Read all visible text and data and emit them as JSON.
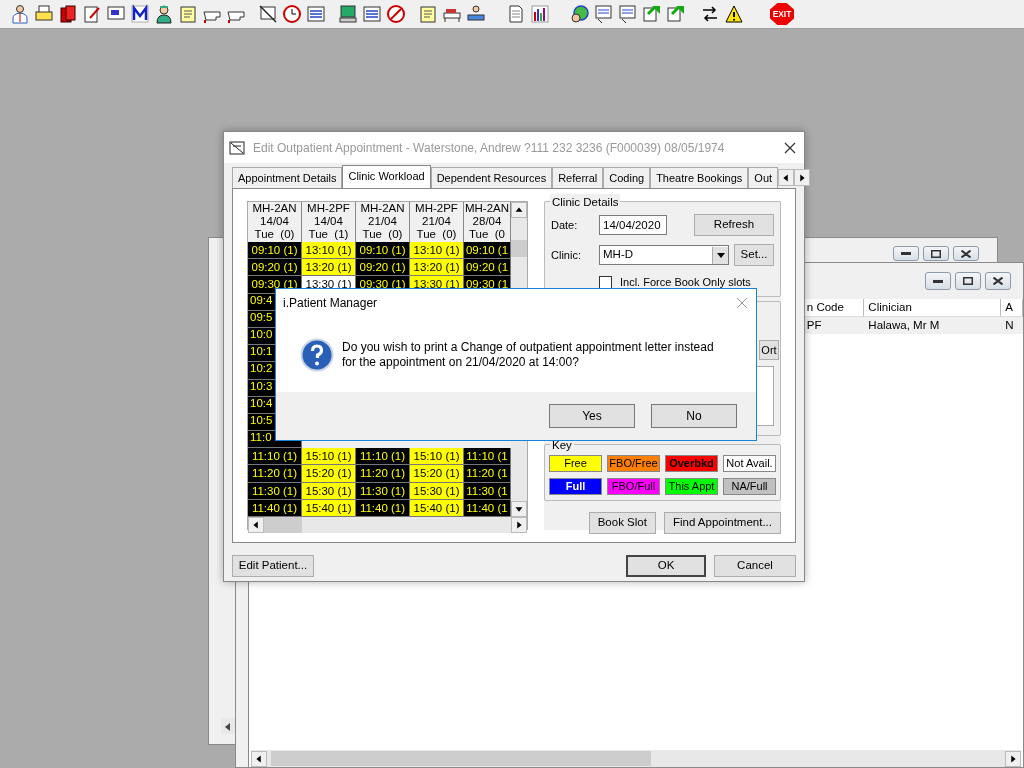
{
  "toolbar": {
    "exit_label": "EXIT"
  },
  "list_window": {
    "columns": [
      "n Code",
      "Clinician",
      "A"
    ],
    "rows": [
      [
        "PF",
        "Halawa, Mr M",
        "N"
      ]
    ]
  },
  "dialog": {
    "title": "Edit Outpatient Appointment - Waterstone, Andrew ?111 232 3236 (F000039) 08/05/1974",
    "tabs": [
      {
        "label": "Appointment Details",
        "selected": false
      },
      {
        "label": "Clinic Workload",
        "selected": true
      },
      {
        "label": "Dependent Resources",
        "selected": false
      },
      {
        "label": "Referral",
        "selected": false
      },
      {
        "label": "Coding",
        "selected": false
      },
      {
        "label": "Theatre Bookings",
        "selected": false
      },
      {
        "label": "Out",
        "selected": false
      }
    ],
    "grid": {
      "columns": [
        {
          "code": "MH-2AN",
          "date": "14/04",
          "day": "Tue  (0)"
        },
        {
          "code": "MH-2PF",
          "date": "14/04",
          "day": "Tue  (1)"
        },
        {
          "code": "MH-2AN",
          "date": "21/04",
          "day": "Tue  (0)"
        },
        {
          "code": "MH-2PF",
          "date": "21/04",
          "day": "Tue  (0)"
        },
        {
          "code": "MH-2AN",
          "date": "28/04",
          "day": "Tue  (0"
        }
      ],
      "rows": [
        {
          "cells": [
            {
              "text": "09:10 (1)",
              "color": "#000000"
            },
            {
              "text": "13:10 (1)",
              "color": "#ffff00"
            },
            {
              "text": "09:10 (1)",
              "color": "#000000"
            },
            {
              "text": "13:10 (1)",
              "color": "#ffff00"
            },
            {
              "text": "09:10 (1",
              "color": "#000000"
            }
          ]
        },
        {
          "cells": [
            {
              "text": "09:20 (1)",
              "color": "#000000"
            },
            {
              "text": "13:20 (1)",
              "color": "#ffff00"
            },
            {
              "text": "09:20 (1)",
              "color": "#000000"
            },
            {
              "text": "13:20 (1)",
              "color": "#ffff00"
            },
            {
              "text": "09:20 (1",
              "color": "#000000"
            }
          ]
        },
        {
          "cells": [
            {
              "text": "09:30 (1)",
              "color": "#000000"
            },
            {
              "text": "13:30 (1)",
              "color": "#ffffff"
            },
            {
              "text": "09:30 (1)",
              "color": "#000000"
            },
            {
              "text": "13:30 (1)",
              "color": "#ffff00"
            },
            {
              "text": "09:30 (1",
              "color": "#000000"
            }
          ]
        },
        {
          "cells": [
            {
              "text": "09:4",
              "color": "#000000"
            }
          ]
        },
        {
          "cells": [
            {
              "text": "09:5",
              "color": "#000000"
            }
          ]
        },
        {
          "cells": [
            {
              "text": "10:0",
              "color": "#000000"
            }
          ]
        },
        {
          "cells": [
            {
              "text": "10:1",
              "color": "#000000"
            }
          ]
        },
        {
          "cells": [
            {
              "text": "10:2",
              "color": "#000000"
            }
          ]
        },
        {
          "cells": [
            {
              "text": "10:3",
              "color": "#000000"
            }
          ]
        },
        {
          "cells": [
            {
              "text": "10:4",
              "color": "#000000"
            }
          ]
        },
        {
          "cells": [
            {
              "text": "10:5",
              "color": "#000000"
            }
          ]
        },
        {
          "cells": [
            {
              "text": "11:0",
              "color": "#000000"
            }
          ]
        },
        {
          "cells": [
            {
              "text": "11:10 (1)",
              "color": "#000000"
            },
            {
              "text": "15:10 (1)",
              "color": "#ffff00"
            },
            {
              "text": "11:10 (1)",
              "color": "#000000"
            },
            {
              "text": "15:10 (1)",
              "color": "#ffff00"
            },
            {
              "text": "11:10 (1",
              "color": "#000000"
            }
          ]
        },
        {
          "cells": [
            {
              "text": "11:20 (1)",
              "color": "#000000"
            },
            {
              "text": "15:20 (1)",
              "color": "#ffff00"
            },
            {
              "text": "11:20 (1)",
              "color": "#000000"
            },
            {
              "text": "15:20 (1)",
              "color": "#ffff00"
            },
            {
              "text": "11:20 (1",
              "color": "#000000"
            }
          ]
        },
        {
          "cells": [
            {
              "text": "11:30 (1)",
              "color": "#000000"
            },
            {
              "text": "15:30 (1)",
              "color": "#ffff00"
            },
            {
              "text": "11:30 (1)",
              "color": "#000000"
            },
            {
              "text": "15:30 (1)",
              "color": "#ffff00"
            },
            {
              "text": "11:30 (1",
              "color": "#000000"
            }
          ]
        },
        {
          "cells": [
            {
              "text": "11:40 (1)",
              "color": "#000000"
            },
            {
              "text": "15:40 (1)",
              "color": "#ffff00"
            },
            {
              "text": "11:40 (1)",
              "color": "#000000"
            },
            {
              "text": "15:40 (1)",
              "color": "#ffff00"
            },
            {
              "text": "11:40 (1",
              "color": "#000000"
            }
          ]
        }
      ]
    },
    "clinic_details": {
      "legend": "Clinic Details",
      "date_label": "Date:",
      "date_value": "14/04/2020",
      "refresh": "Refresh",
      "clinic_label": "Clinic:",
      "clinic_value": "MH-D",
      "set": "Set...",
      "force_book": {
        "label": "Incl. Force Book Only slots",
        "checked": false
      }
    },
    "sort_button": "Ort",
    "key": {
      "legend": "Key",
      "items": [
        {
          "label": "Free",
          "color": "#ffff00",
          "bold": false
        },
        {
          "label": "FBO/Free",
          "color": "#ff8000",
          "bold": false
        },
        {
          "label": "Overbkd",
          "color": "#ff0000",
          "bold": true
        },
        {
          "label": "Not Avail.",
          "color": "#ffffff",
          "bold": false
        },
        {
          "label": "Full",
          "color": "#0000ff",
          "bold": true
        },
        {
          "label": "FBO/Full",
          "color": "#ff00ff",
          "bold": false
        },
        {
          "label": "This Appt",
          "color": "#00ff00",
          "bold": false
        },
        {
          "label": "NA/Full",
          "color": "#c0c0c0",
          "bold": false
        }
      ]
    },
    "actions": [
      "Book Slot",
      "Find Appointment..."
    ],
    "footer": {
      "edit_patient": "Edit Patient...",
      "ok": "OK",
      "cancel": "Cancel"
    }
  },
  "message_box": {
    "title": "i.Patient Manager",
    "text": "Do you wish to print a Change of outpatient appointment letter instead\nfor the appointment on 21/04/2020 at 14:00?",
    "buttons": [
      "Yes",
      "No"
    ]
  }
}
